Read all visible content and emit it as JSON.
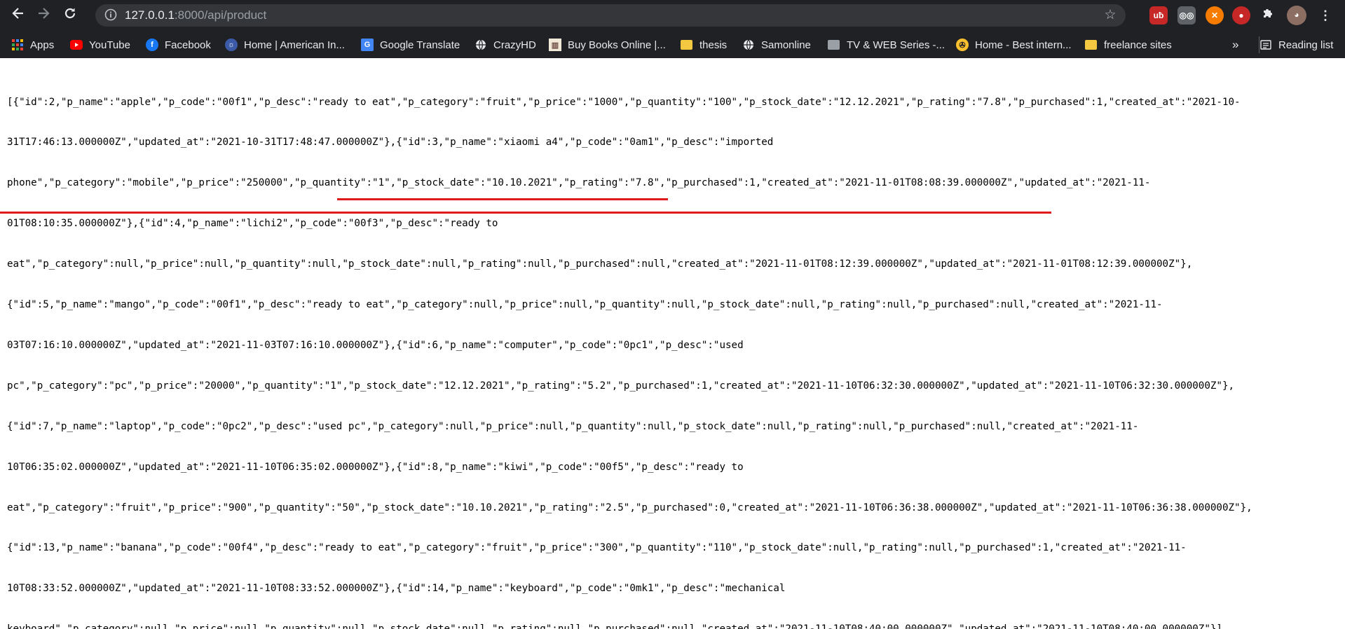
{
  "browser": {
    "url_host": "127.0.0.1",
    "url_path": ":8000/api/product",
    "icons": {
      "back": "arrow-left-icon",
      "forward": "arrow-right-icon",
      "reload": "reload-icon",
      "info": "info-icon",
      "star": "star-icon",
      "extensions": "puzzle-icon",
      "menu": "kebab-menu-icon"
    }
  },
  "bookmarks": {
    "items": [
      {
        "label": "Apps",
        "icon": "apps-grid-icon"
      },
      {
        "label": "YouTube",
        "icon": "youtube-icon"
      },
      {
        "label": "Facebook",
        "icon": "facebook-icon"
      },
      {
        "label": "Home | American In...",
        "icon": "american-icon"
      },
      {
        "label": "Google Translate",
        "icon": "google-translate-icon"
      },
      {
        "label": "CrazyHD",
        "icon": "globe-icon"
      },
      {
        "label": "Buy Books Online |...",
        "icon": "books-icon"
      },
      {
        "label": "thesis",
        "icon": "folder-icon"
      },
      {
        "label": "Samonline",
        "icon": "globe-icon"
      },
      {
        "label": "TV & WEB Series -...",
        "icon": "folder-icon"
      },
      {
        "label": "Home - Best intern...",
        "icon": "best-internet-icon"
      },
      {
        "label": "freelance sites",
        "icon": "folder-icon"
      }
    ],
    "overflow_label": "»",
    "reading_list_label": "Reading list"
  },
  "json_response": {
    "lines": [
      "[{\"id\":2,\"p_name\":\"apple\",\"p_code\":\"00f1\",\"p_desc\":\"ready to eat\",\"p_category\":\"fruit\",\"p_price\":\"1000\",\"p_quantity\":\"100\",\"p_stock_date\":\"12.12.2021\",\"p_rating\":\"7.8\",\"p_purchased\":1,\"created_at\":\"2021-10-",
      "31T17:46:13.000000Z\",\"updated_at\":\"2021-10-31T17:48:47.000000Z\"},{\"id\":3,\"p_name\":\"xiaomi a4\",\"p_code\":\"0am1\",\"p_desc\":\"imported",
      "phone\",\"p_category\":\"mobile\",\"p_price\":\"250000\",\"p_quantity\":\"1\",\"p_stock_date\":\"10.10.2021\",\"p_rating\":\"7.8\",\"p_purchased\":1,\"created_at\":\"2021-11-01T08:08:39.000000Z\",\"updated_at\":\"2021-11-",
      "01T08:10:35.000000Z\"},{\"id\":4,\"p_name\":\"lichi2\",\"p_code\":\"00f3\",\"p_desc\":\"ready to",
      "eat\",\"p_category\":null,\"p_price\":null,\"p_quantity\":null,\"p_stock_date\":null,\"p_rating\":null,\"p_purchased\":null,\"created_at\":\"2021-11-01T08:12:39.000000Z\",\"updated_at\":\"2021-11-01T08:12:39.000000Z\"},",
      "{\"id\":5,\"p_name\":\"mango\",\"p_code\":\"00f1\",\"p_desc\":\"ready to eat\",\"p_category\":null,\"p_price\":null,\"p_quantity\":null,\"p_stock_date\":null,\"p_rating\":null,\"p_purchased\":null,\"created_at\":\"2021-11-",
      "03T07:16:10.000000Z\",\"updated_at\":\"2021-11-03T07:16:10.000000Z\"},{\"id\":6,\"p_name\":\"computer\",\"p_code\":\"0pc1\",\"p_desc\":\"used",
      "pc\",\"p_category\":\"pc\",\"p_price\":\"20000\",\"p_quantity\":\"1\",\"p_stock_date\":\"12.12.2021\",\"p_rating\":\"5.2\",\"p_purchased\":1,\"created_at\":\"2021-11-10T06:32:30.000000Z\",\"updated_at\":\"2021-11-10T06:32:30.000000Z\"},",
      "{\"id\":7,\"p_name\":\"laptop\",\"p_code\":\"0pc2\",\"p_desc\":\"used pc\",\"p_category\":null,\"p_price\":null,\"p_quantity\":null,\"p_stock_date\":null,\"p_rating\":null,\"p_purchased\":null,\"created_at\":\"2021-11-",
      "10T06:35:02.000000Z\",\"updated_at\":\"2021-11-10T06:35:02.000000Z\"},{\"id\":8,\"p_name\":\"kiwi\",\"p_code\":\"00f5\",\"p_desc\":\"ready to",
      "eat\",\"p_category\":\"fruit\",\"p_price\":\"900\",\"p_quantity\":\"50\",\"p_stock_date\":\"10.10.2021\",\"p_rating\":\"2.5\",\"p_purchased\":0,\"created_at\":\"2021-11-10T06:36:38.000000Z\",\"updated_at\":\"2021-11-10T06:36:38.000000Z\"},",
      "{\"id\":13,\"p_name\":\"banana\",\"p_code\":\"00f4\",\"p_desc\":\"ready to eat\",\"p_category\":\"fruit\",\"p_price\":\"300\",\"p_quantity\":\"110\",\"p_stock_date\":null,\"p_rating\":null,\"p_purchased\":1,\"created_at\":\"2021-11-",
      "10T08:33:52.000000Z\",\"updated_at\":\"2021-11-10T08:33:52.000000Z\"},{\"id\":14,\"p_name\":\"keyboard\",\"p_code\":\"0mk1\",\"p_desc\":\"mechanical",
      "keyboard\",\"p_category\":null,\"p_price\":null,\"p_quantity\":null,\"p_stock_date\":null,\"p_rating\":null,\"p_purchased\":null,\"created_at\":\"2021-11-10T08:40:00.000000Z\",\"updated_at\":\"2021-11-10T08:40:00.000000Z\"}]"
    ]
  },
  "annotation": {
    "underline_color": "#e0191a"
  }
}
